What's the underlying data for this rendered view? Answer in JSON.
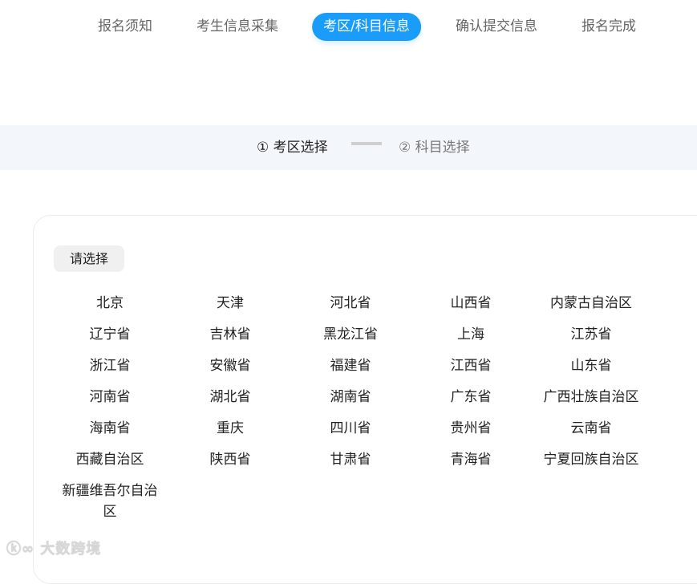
{
  "tabs": [
    "报名须知",
    "考生信息采集",
    "考区/科目信息",
    "确认提交信息",
    "报名完成"
  ],
  "steps": {
    "step1": "① 考区选择",
    "step2": "② 科目选择"
  },
  "select_label": "请选择",
  "regions": [
    "北京",
    "天津",
    "河北省",
    "山西省",
    "内蒙古自治区",
    "辽宁省",
    "吉林省",
    "黑龙江省",
    "上海",
    "江苏省",
    "浙江省",
    "安徽省",
    "福建省",
    "江西省",
    "山东省",
    "河南省",
    "湖北省",
    "湖南省",
    "广东省",
    "广西壮族自治区",
    "海南省",
    "重庆",
    "四川省",
    "贵州省",
    "云南省",
    "西藏自治区",
    "陕西省",
    "甘肃省",
    "青海省",
    "宁夏回族自治区",
    "新疆维吾尔自治区"
  ],
  "watermark": "大数跨境",
  "colors": {
    "accent": "#1a9dfa",
    "band": "#f3f7fc"
  }
}
